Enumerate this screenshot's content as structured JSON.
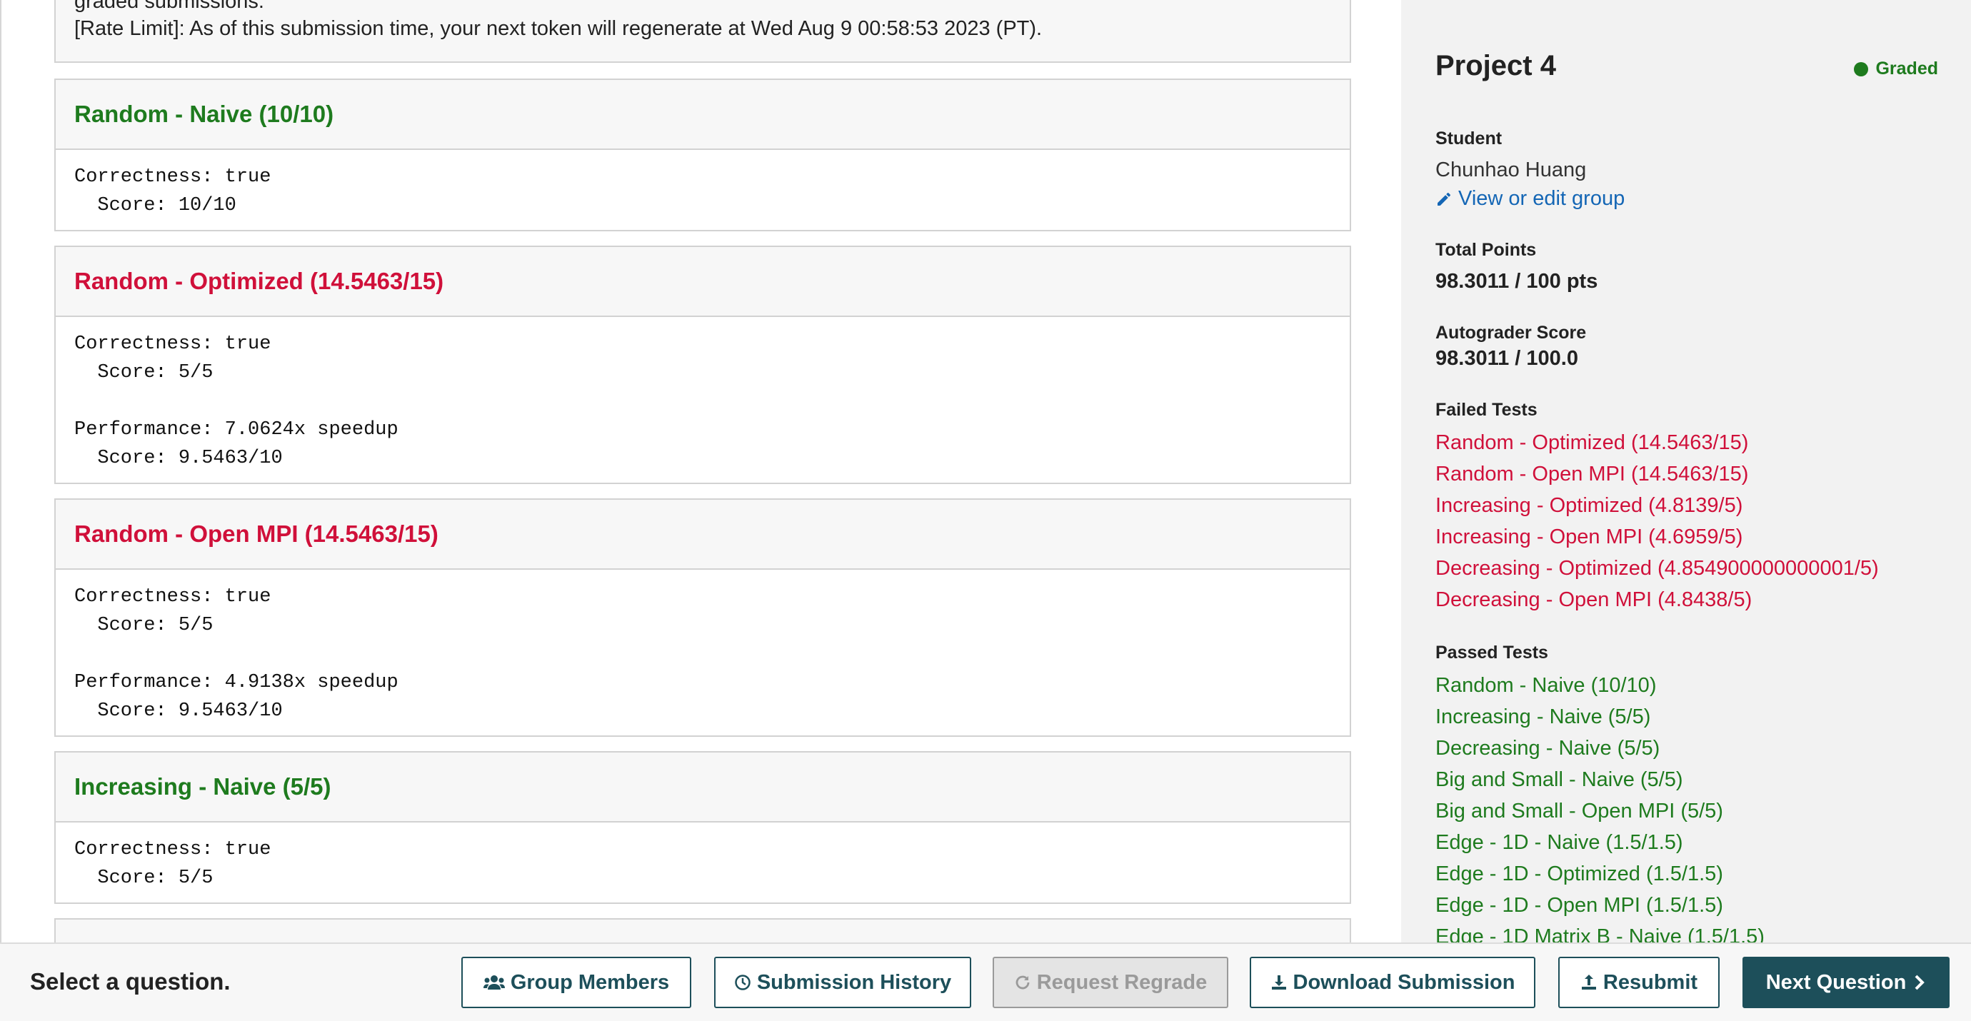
{
  "rate_box": {
    "line1": "graded submissions.",
    "line2": "[Rate Limit]: As of this submission time, your next token will regenerate at Wed Aug 9 00:58:53 2023 (PT)."
  },
  "tests": [
    {
      "title": "Random - Naive (10/10)",
      "status": "pass",
      "body": "Correctness: true\n  Score: 10/10"
    },
    {
      "title": "Random - Optimized (14.5463/15)",
      "status": "fail",
      "body": "Correctness: true\n  Score: 5/5\n\nPerformance: 7.0624x speedup\n  Score: 9.5463/10"
    },
    {
      "title": "Random - Open MPI (14.5463/15)",
      "status": "fail",
      "body": "Correctness: true\n  Score: 5/5\n\nPerformance: 4.9138x speedup\n  Score: 9.5463/10"
    },
    {
      "title": "Increasing - Naive (5/5)",
      "status": "pass",
      "body": "Correctness: true\n  Score: 5/5"
    }
  ],
  "sidebar": {
    "title": "Project 4",
    "status": "Graded",
    "student_label": "Student",
    "student_name": "Chunhao Huang",
    "edit_group": "View or edit group",
    "total_points_label": "Total Points",
    "total_points": "98.3011 / 100 pts",
    "autograder_label": "Autograder Score",
    "autograder_score": "98.3011 / 100.0",
    "failed_label": "Failed Tests",
    "failed_tests": [
      "Random - Optimized (14.5463/15)",
      "Random - Open MPI (14.5463/15)",
      "Increasing - Optimized (4.8139/5)",
      "Increasing - Open MPI (4.6959/5)",
      "Decreasing - Optimized (4.854900000000001/5)",
      "Decreasing - Open MPI (4.8438/5)"
    ],
    "passed_label": "Passed Tests",
    "passed_tests": [
      "Random - Naive (10/10)",
      "Increasing - Naive (5/5)",
      "Decreasing - Naive (5/5)",
      "Big and Small - Naive (5/5)",
      "Big and Small - Open MPI (5/5)",
      "Edge - 1D - Naive (1.5/1.5)",
      "Edge - 1D - Optimized (1.5/1.5)",
      "Edge - 1D - Open MPI (1.5/1.5)",
      "Edge - 1D Matrix B - Naive (1.5/1.5)"
    ]
  },
  "bottombar": {
    "prompt": "Select a question.",
    "group_members": "Group Members",
    "submission_history": "Submission History",
    "request_regrade": "Request Regrade",
    "download_submission": "Download Submission",
    "resubmit": "Resubmit",
    "next_question": "Next Question"
  },
  "colors": {
    "pass": "#1e7b1e",
    "fail": "#d0103a",
    "link": "#1466b5",
    "button": "#1d4f5a"
  },
  "icons": [
    "pencil-icon",
    "users-icon",
    "clock-icon",
    "refresh-icon",
    "download-icon",
    "upload-icon",
    "chevron-right-icon"
  ]
}
